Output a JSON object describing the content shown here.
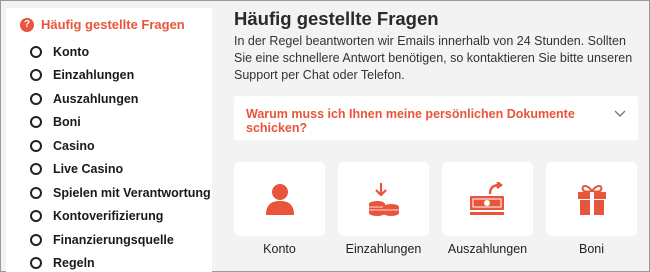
{
  "sidebar": {
    "heading": "Häufig gestellte Fragen",
    "items": [
      {
        "label": "Konto"
      },
      {
        "label": "Einzahlungen"
      },
      {
        "label": "Auszahlungen"
      },
      {
        "label": "Boni"
      },
      {
        "label": "Casino"
      },
      {
        "label": "Live Casino"
      },
      {
        "label": "Spielen mit Verantwortung"
      },
      {
        "label": "Kontoverifizierung"
      },
      {
        "label": "Finanzierungsquelle"
      },
      {
        "label": "Regeln"
      }
    ]
  },
  "main": {
    "title": "Häufig gestellte Fragen",
    "intro": "In der Regel beantworten wir Emails innerhalb von 24 Stunden. Sollten Sie eine schnellere Antwort benötigen, so kontaktieren Sie bitte unseren Support per Chat oder Telefon.",
    "faq_question": "Warum muss ich Ihnen meine persönlichen Dokumente schicken?",
    "cards": [
      {
        "label": "Konto",
        "icon": "user-icon"
      },
      {
        "label": "Einzahlungen",
        "icon": "coins-deposit-icon"
      },
      {
        "label": "Auszahlungen",
        "icon": "cash-withdraw-icon"
      },
      {
        "label": "Boni",
        "icon": "gift-icon"
      }
    ]
  },
  "colors": {
    "accent": "#e8553a",
    "background": "#f3f3f3",
    "panel": "#ffffff",
    "text": "#2a2a2a"
  }
}
